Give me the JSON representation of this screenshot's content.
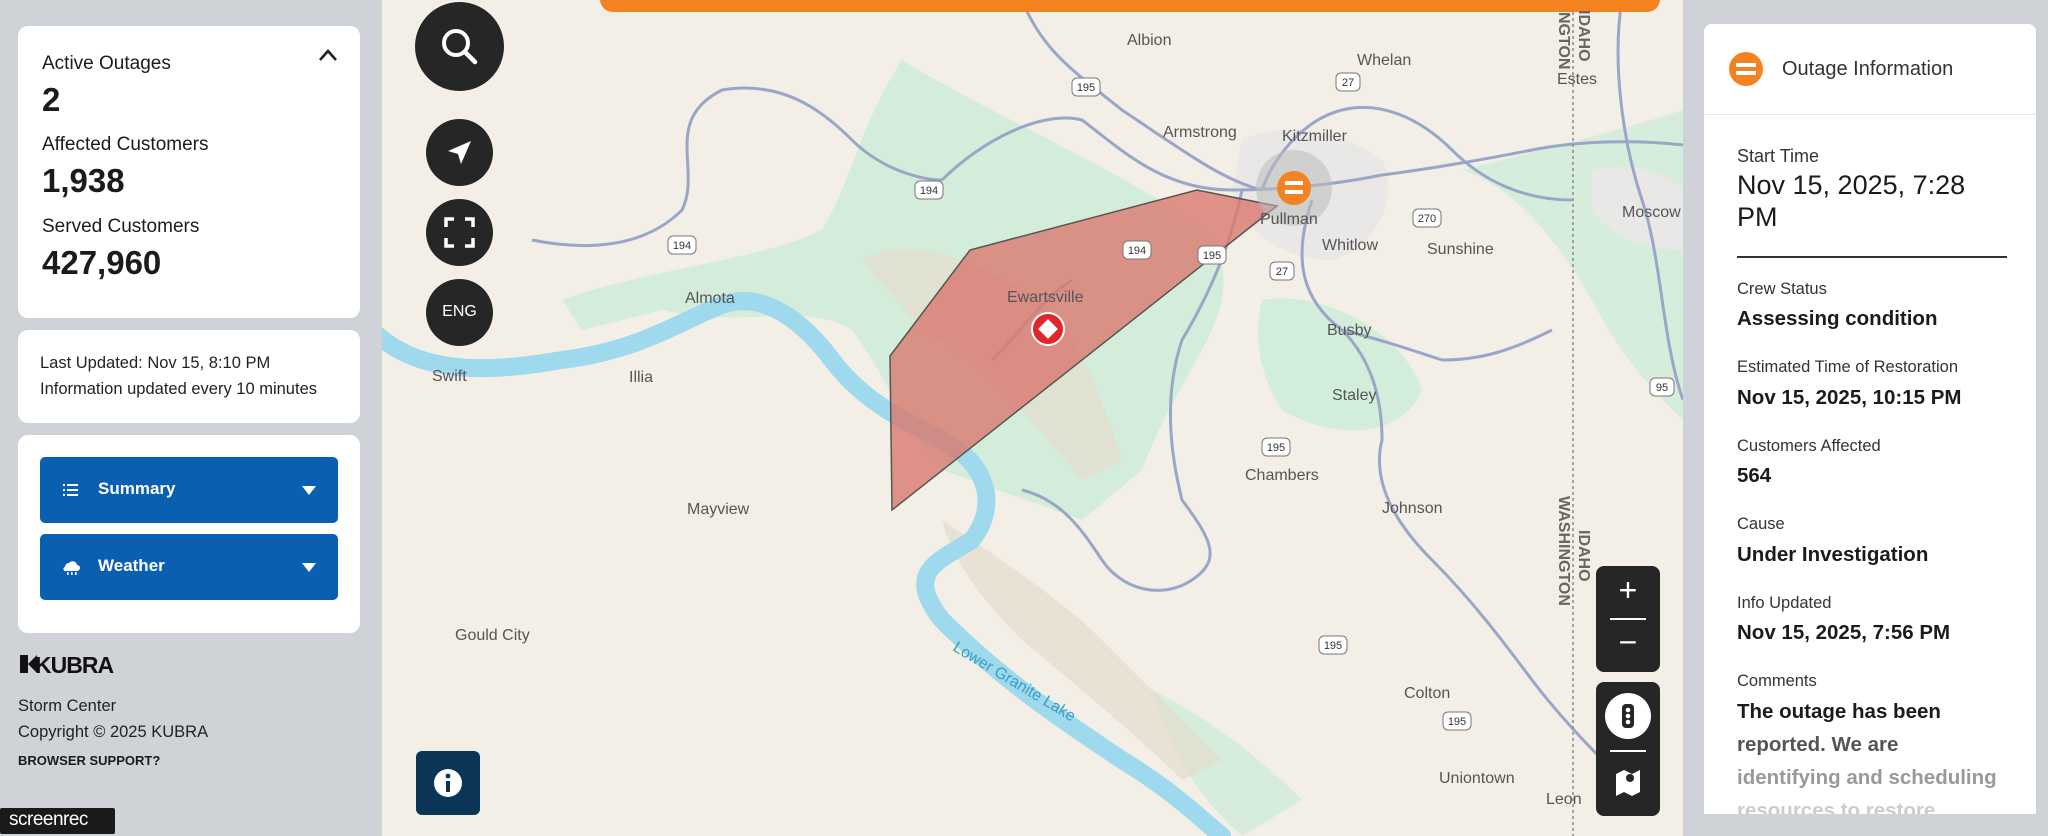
{
  "summary": {
    "active_outages_label": "Active Outages",
    "active_outages_value": "2",
    "affected_customers_label": "Affected Customers",
    "affected_customers_value": "1,938",
    "served_customers_label": "Served Customers",
    "served_customers_value": "427,960"
  },
  "update_info": {
    "last_updated": "Last Updated:  Nov 15, 8:10 PM",
    "interval": "Information updated every 10 minutes"
  },
  "accordions": {
    "summary_label": "Summary",
    "weather_label": "Weather"
  },
  "footer": {
    "logo_text": "KUBRA",
    "app_name": "Storm Center",
    "copyright": "Copyright © 2025 KUBRA",
    "browser_support": "BROWSER SUPPORT?"
  },
  "watermark": "screenrec",
  "map_controls": {
    "language_label": "ENG",
    "zoom_in": "+",
    "zoom_out": "−"
  },
  "map_labels": {
    "albion": "Albion",
    "whelan": "Whelan",
    "estes": "Estes",
    "armstrong": "Armstrong",
    "kitzmiller": "Kitzmiller",
    "moscow": "Moscow",
    "pullman": "Pullman",
    "whitlow": "Whitlow",
    "sunshine": "Sunshine",
    "almota": "Almota",
    "ewartsville": "Ewartsville",
    "busby": "Busby",
    "swift": "Swift",
    "illia": "Illia",
    "staley": "Staley",
    "chambers": "Chambers",
    "johnson": "Johnson",
    "mayview": "Mayview",
    "gould_city": "Gould City",
    "colton": "Colton",
    "uniontown": "Uniontown",
    "leon": "Leon",
    "lower_granite_lake": "Lower Granite Lake",
    "idaho": "IDAHO",
    "washington": "WASHINGTON",
    "idaho_top": "IDAHO",
    "ngton_top": "NGTON"
  },
  "route_shields": {
    "r195_a": "195",
    "r27_a": "27",
    "r194_a": "194",
    "r194_b": "194",
    "r270": "270",
    "r194_c": "194",
    "r195_b": "195",
    "r27_b": "27",
    "r195_c": "195",
    "r95": "95",
    "r195_d": "195",
    "r195_e": "195"
  },
  "outage_info": {
    "panel_title": "Outage Information",
    "start_time_label": "Start Time",
    "start_time_value_line1": "Nov 15, 2025, 7:28",
    "start_time_value_line2": "PM",
    "crew_status_label": "Crew Status",
    "crew_status_value": "Assessing condition",
    "etr_label": "Estimated Time of Restoration",
    "etr_value": "Nov 15, 2025, 10:15 PM",
    "customers_affected_label": "Customers Affected",
    "customers_affected_value": "564",
    "cause_label": "Cause",
    "cause_value": "Under Investigation",
    "info_updated_label": "Info Updated",
    "info_updated_value": "Nov 15, 2025, 7:56 PM",
    "comments_label": "Comments",
    "comments_line1": "The outage has been",
    "comments_line2": "reported. We are",
    "comments_line3": "identifying and scheduling",
    "comments_line4": "resources to restore"
  },
  "colors": {
    "brand_blue": "#0b5fb1",
    "outage_orange": "#f58220",
    "outage_polygon": "#d9786f",
    "water": "#9fd9ee",
    "dark_control": "#262626"
  }
}
